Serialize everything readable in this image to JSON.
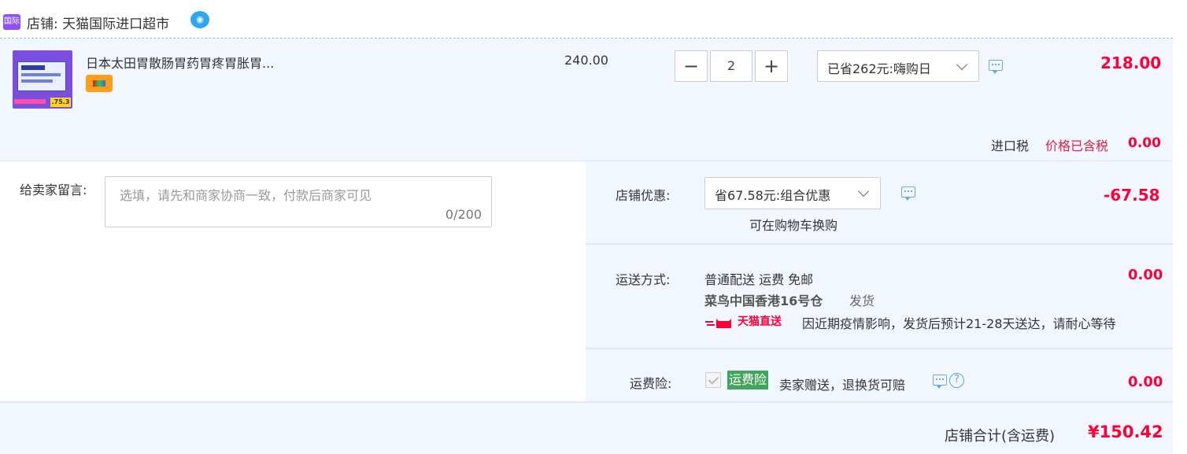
{
  "shop": {
    "badge": "国际",
    "label": "店铺: 天猫国际进口超市"
  },
  "item": {
    "name": "日本太田胃散肠胃药胃疼胃胀胃...",
    "image_tag": ".75.3",
    "unit_price": "240.00",
    "quantity": "2",
    "promo": "已省262元:嗨购日",
    "total": "218.00",
    "tax_label": "进口税",
    "tax_note": "价格已含税",
    "tax_value": "0.00"
  },
  "message": {
    "label": "给卖家留言:",
    "placeholder": "选填，请先和商家协商一致，付款后商家可见",
    "counter": "0/200"
  },
  "discount": {
    "label": "店铺优惠:",
    "selected": "省67.58元:组合优惠",
    "note": "可在购物车换购",
    "value": "-67.58"
  },
  "shipping": {
    "label": "运送方式:",
    "method": "普通配送 运费 免邮",
    "warehouse": "菜鸟中国香港16号仓",
    "ship_word": "发货",
    "brand": "天猫直送",
    "notice": "因近期疫情影响，发货后预计21-28天送达，请耐心等待",
    "value": "0.00"
  },
  "insurance": {
    "label": "运费险:",
    "badge": "运费险",
    "desc": "卖家赠送，退换货可赔",
    "value": "0.00"
  },
  "footer": {
    "label": "店铺合计(含运费)",
    "total": "¥150.42"
  },
  "colors": {
    "accent_red": "#ff0036",
    "panel_bg": "#f2f7ff",
    "insurance_green": "#3ea55a",
    "badge_purple": "#8c52f5"
  }
}
